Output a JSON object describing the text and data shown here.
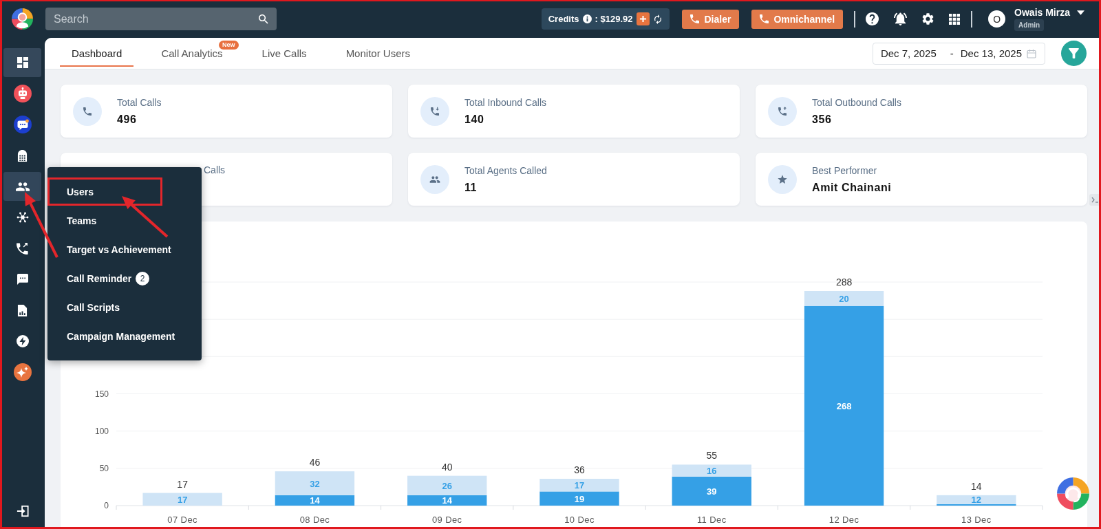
{
  "topbar": {
    "search": {
      "placeholder": "Search"
    },
    "credits": {
      "label": "Credits",
      "amount": ": $129.92"
    },
    "buttons": [
      {
        "label": "Dialer"
      },
      {
        "label": "Omnichannel"
      }
    ],
    "user": {
      "initial": "O",
      "name": "Owais Mirza",
      "role": "Admin"
    }
  },
  "sidebar": {
    "items": [
      {
        "selected": true,
        "expanded": false
      },
      {
        "selected": false,
        "expanded": false
      },
      {
        "selected": false,
        "expanded": false
      },
      {
        "selected": false,
        "expanded": false
      },
      {
        "selected": false,
        "expanded": true,
        "submenu": [
          {
            "label": "Users",
            "highlighted": true
          },
          {
            "label": "Teams",
            "highlighted": false
          },
          {
            "label": "Target vs Achievement",
            "highlighted": false
          },
          {
            "label": "Call Reminder",
            "badge": "2",
            "highlighted": false
          },
          {
            "label": "Call Scripts",
            "highlighted": false
          },
          {
            "label": "Campaign Management",
            "highlighted": false
          }
        ]
      },
      {
        "selected": false,
        "expanded": false
      },
      {
        "selected": false,
        "expanded": false
      },
      {
        "selected": false,
        "expanded": false
      },
      {
        "selected": false,
        "expanded": false
      },
      {
        "selected": false,
        "expanded": false
      },
      {
        "selected": false,
        "expanded": false
      }
    ]
  },
  "tabs": [
    {
      "label": "Dashboard",
      "selected": true
    },
    {
      "label": "Call Analytics",
      "selected": false,
      "badge": "New"
    },
    {
      "label": "Live Calls",
      "selected": false
    },
    {
      "label": "Monitor Users",
      "selected": false
    }
  ],
  "date_range": {
    "start": "Dec 7, 2025",
    "separator": "-",
    "end": "Dec 13, 2025"
  },
  "stats": [
    {
      "label": "Total Calls",
      "value": "496",
      "covered": false
    },
    {
      "label": "Total Inbound Calls",
      "value": "140",
      "covered": false
    },
    {
      "label": "Total Outbound Calls",
      "value": "356",
      "covered": false
    },
    {
      "label": "Calls",
      "covered": true
    },
    {
      "label": "Total Agents Called",
      "value": "11",
      "covered": false
    },
    {
      "label": "Best Performer",
      "value": "Amit Chainani",
      "covered": false
    }
  ],
  "chart": {
    "chart_data": {
      "type": "bar",
      "stacked": true,
      "grid": true,
      "categories": [
        "07 Dec",
        "08 Dec",
        "09 Dec",
        "10 Dec",
        "11 Dec",
        "12 Dec",
        "13 Dec"
      ],
      "series": [
        {
          "color": "#35a0e6",
          "values": [
            0,
            14,
            14,
            19,
            39,
            268,
            2
          ]
        },
        {
          "color": "#cfe4f6",
          "values": [
            17,
            32,
            26,
            17,
            16,
            20,
            12
          ]
        }
      ],
      "ylim": [
        0,
        300
      ],
      "yticks": [
        0,
        50,
        100,
        150
      ],
      "value_labels": [
        [
          null,
          "14",
          "14",
          "19",
          "39",
          "268",
          null
        ],
        [
          "17",
          "32",
          "26",
          "17",
          "16",
          "20",
          "12"
        ]
      ],
      "annotations": [
        "17",
        "46",
        "40",
        "36",
        "55",
        "288",
        "14"
      ]
    }
  }
}
